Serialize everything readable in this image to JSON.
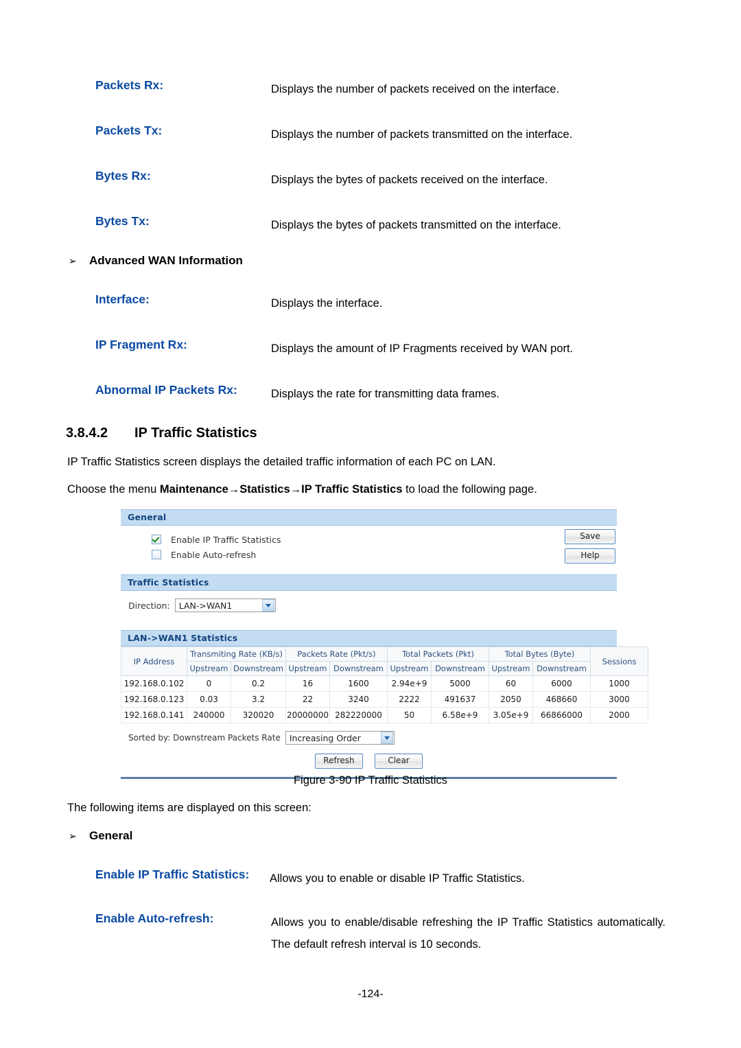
{
  "definitions_top": [
    {
      "term": "Packets Rx:",
      "desc": "Displays the number of packets received on the interface."
    },
    {
      "term": "Packets Tx:",
      "desc": "Displays the number of packets transmitted on the interface."
    },
    {
      "term": "Bytes Rx:",
      "desc": "Displays the bytes of packets received on the interface."
    },
    {
      "term": "Bytes Tx:",
      "desc": "Displays the bytes of packets transmitted on the interface."
    }
  ],
  "advanced_wan": {
    "bullet": "➢",
    "heading": "Advanced WAN Information",
    "items": [
      {
        "term": "Interface:",
        "desc": "Displays the interface."
      },
      {
        "term": "IP Fragment Rx:",
        "desc": "Displays the amount of IP Fragments received by WAN port."
      },
      {
        "term": "Abnormal IP Packets Rx:",
        "desc": "Displays the rate for transmitting data frames."
      }
    ]
  },
  "section": {
    "number": "3.8.4.2",
    "title": "IP Traffic Statistics",
    "intro": "IP Traffic Statistics screen displays the detailed traffic information of each PC on LAN.",
    "choose_prefix": "Choose the menu ",
    "choose_menu": "Maintenance→Statistics→IP Traffic Statistics",
    "choose_suffix": " to load the following page."
  },
  "ui": {
    "general_bar": "General",
    "checkboxes": [
      {
        "label": "Enable IP Traffic Statistics",
        "checked": true
      },
      {
        "label": "Enable Auto-refresh",
        "checked": false
      }
    ],
    "save_label": "Save",
    "help_label": "Help",
    "traffic_bar": "Traffic Statistics",
    "direction_label": "Direction:",
    "direction_value": "LAN->WAN1",
    "table_bar": "LAN->WAN1 Statistics",
    "table": {
      "group_headers": [
        "IP Address",
        "Transmiting Rate (KB/s)",
        "Packets Rate (Pkt/s)",
        "Total Packets (Pkt)",
        "Total Bytes (Byte)",
        "Sessions"
      ],
      "sub_headers": [
        "Upstream",
        "Downstream",
        "Upstream",
        "Downstream",
        "Upstream",
        "Downstream",
        "Upstream",
        "Downstream"
      ],
      "rows": [
        {
          "ip": "192.168.0.102",
          "tx_rate_up": "0",
          "tx_rate_down": "0.2",
          "pkt_rate_up": "16",
          "pkt_rate_down": "1600",
          "total_pkt_up": "2.94e+9",
          "total_pkt_down": "5000",
          "total_bytes_up": "60",
          "total_bytes_down": "6000",
          "sessions": "1000"
        },
        {
          "ip": "192.168.0.123",
          "tx_rate_up": "0.03",
          "tx_rate_down": "3.2",
          "pkt_rate_up": "22",
          "pkt_rate_down": "3240",
          "total_pkt_up": "2222",
          "total_pkt_down": "491637",
          "total_bytes_up": "2050",
          "total_bytes_down": "468660",
          "sessions": "3000"
        },
        {
          "ip": "192.168.0.141",
          "tx_rate_up": "240000",
          "tx_rate_down": "320020",
          "pkt_rate_up": "20000000",
          "pkt_rate_down": "282220000",
          "total_pkt_up": "50",
          "total_pkt_down": "6.58e+9",
          "total_bytes_up": "3.05e+9",
          "total_bytes_down": "66866000",
          "sessions": "2000"
        }
      ]
    },
    "sorted_by_label": "Sorted by: Downstream Packets Rate",
    "sorted_by_value": "Increasing Order",
    "refresh_label": "Refresh",
    "clear_label": "Clear"
  },
  "figure_caption": "Figure 3-90 IP Traffic Statistics",
  "following_items": "The following items are displayed on this screen:",
  "general_group": {
    "bullet": "➢",
    "heading": "General",
    "items": [
      {
        "term": "Enable IP Traffic Statistics:",
        "desc": "Allows you to enable or disable IP Traffic Statistics."
      },
      {
        "term": "Enable Auto-refresh:",
        "desc": "Allows you to enable/disable refreshing the IP Traffic Statistics automatically. The default refresh interval is 10 seconds."
      }
    ]
  },
  "page_number": "-124-",
  "colors": {
    "term_blue": "#0B4AA2",
    "ui_bar_blue": "#C3DCF2",
    "ui_bar_text": "#13437E",
    "check_green": "#168F16",
    "rule_blue": "#5B7FA6"
  }
}
